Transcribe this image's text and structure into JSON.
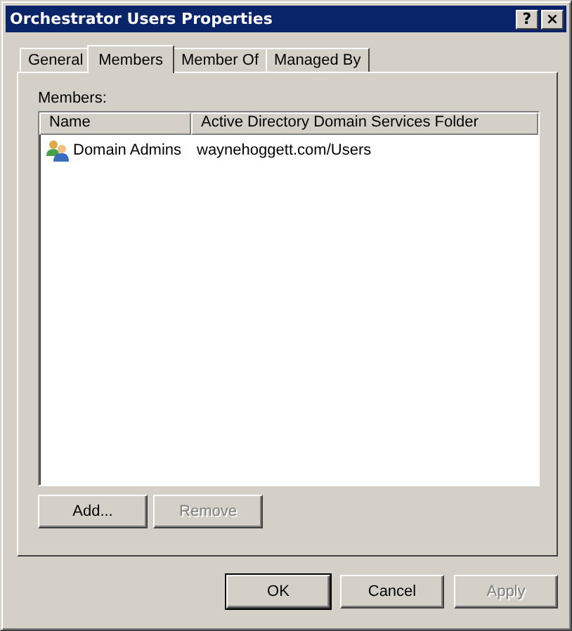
{
  "window": {
    "title": "Orchestrator Users Properties",
    "title_buttons": [
      "?",
      "×"
    ]
  },
  "tabs": [
    {
      "label": "General",
      "selected": false
    },
    {
      "label": "Members",
      "selected": true
    },
    {
      "label": "Member Of",
      "selected": false
    },
    {
      "label": "Managed By",
      "selected": false
    }
  ],
  "members": {
    "label": "Members:",
    "columns": [
      "Name",
      "Active Directory Domain Services Folder"
    ],
    "rows": [
      {
        "name": "Domain Admins",
        "folder": "waynehoggett.com/Users"
      }
    ]
  },
  "list_buttons": [
    {
      "label": "Add...",
      "disabled": false
    },
    {
      "label": "Remove",
      "disabled": true
    }
  ],
  "dialog_buttons": [
    {
      "label": "OK",
      "disabled": false,
      "default": true
    },
    {
      "label": "Cancel",
      "disabled": false,
      "default": false
    },
    {
      "label": "Apply",
      "disabled": true,
      "default": false
    }
  ]
}
